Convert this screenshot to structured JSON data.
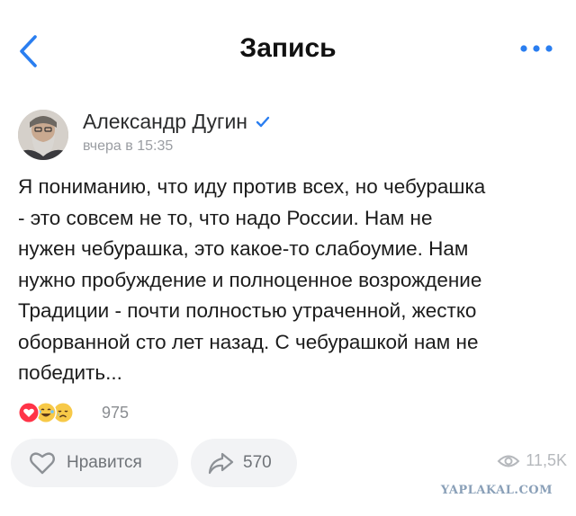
{
  "header": {
    "title": "Запись"
  },
  "post": {
    "author_name": "Александр Дугин",
    "time": "вчера в 15:35",
    "text": "Я пониманию, что иду против всех, но чебурашка\n- это совсем не то, что надо России. Нам не\nнужен чебурашка, это какое-то слабоумие. Нам\nнужно пробуждение и полноценное возрождение\nТрадиции - почти полностью утраченной, жестко\nоборванной сто лет назад. С чебурашкой нам не\nпобедить..."
  },
  "reactions": {
    "icons": [
      "heart-reaction",
      "laughing-reaction",
      "crying-reaction"
    ],
    "count": "975"
  },
  "actions": {
    "like_label": "Нравится",
    "share_count": "570",
    "views_count": "11,5K"
  },
  "watermark": "YAPLAKAL.COM",
  "colors": {
    "accent": "#2a7ef0",
    "heart": "#ff3347",
    "pill_bg": "#f2f3f5",
    "muted": "#9a9da2"
  }
}
